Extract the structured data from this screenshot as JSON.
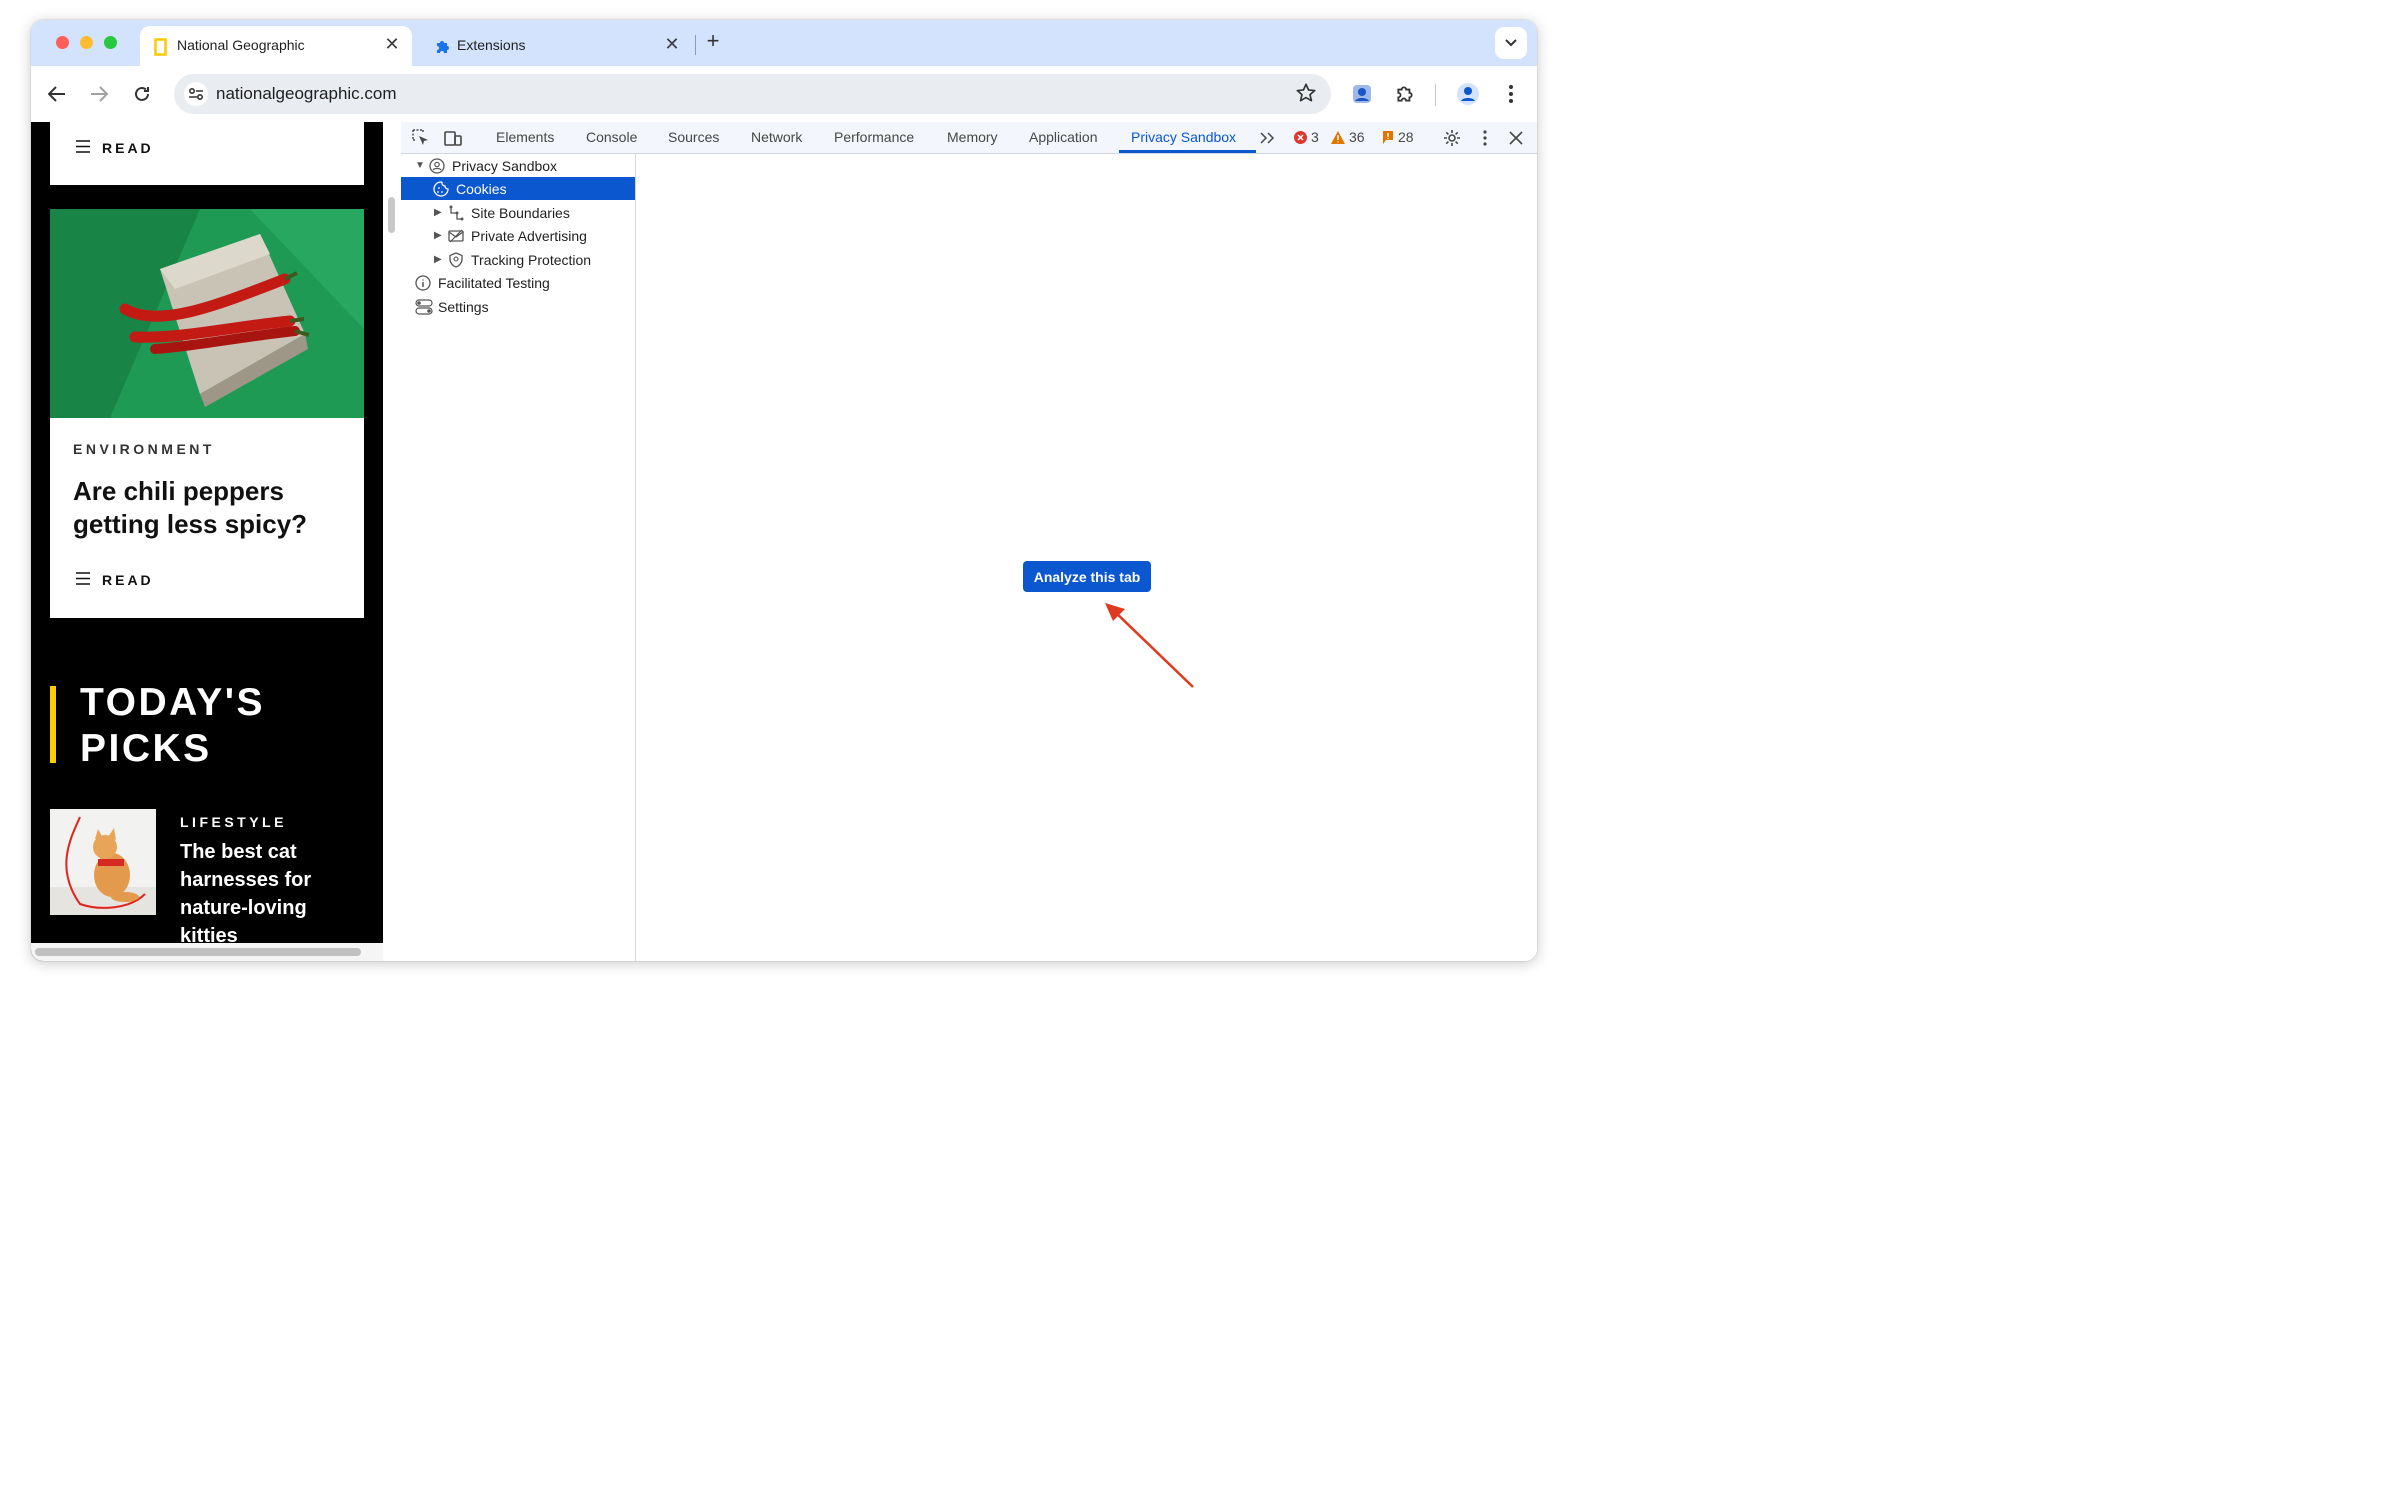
{
  "browser": {
    "tabs": [
      {
        "title": "National Geographic",
        "active": true,
        "favicon": "natgeo-yellow-rect-icon"
      },
      {
        "title": "Extensions",
        "active": false,
        "favicon": "puzzle-icon"
      }
    ],
    "url": "nationalgeographic.com"
  },
  "page": {
    "read_label_top": "READ",
    "card": {
      "kicker": "ENVIRONMENT",
      "headline": "Are chili peppers getting less spicy?",
      "read_label": "READ"
    },
    "section_title": "TODAY'S PICKS",
    "pick": {
      "kicker": "LIFESTYLE",
      "headline": "The best cat harnesses for nature-loving kitties"
    }
  },
  "devtools": {
    "tabs": [
      "Elements",
      "Console",
      "Sources",
      "Network",
      "Performance",
      "Memory",
      "Application",
      "Privacy Sandbox"
    ],
    "active_tab": "Privacy Sandbox",
    "counts": {
      "errors": "3",
      "warnings": "36",
      "issues": "28"
    },
    "tree": {
      "root": "Privacy Sandbox",
      "items": [
        "Cookies",
        "Site Boundaries",
        "Private Advertising",
        "Tracking Protection",
        "Facilitated Testing",
        "Settings"
      ],
      "selected": "Cookies"
    },
    "analyze_button": "Analyze this tab"
  },
  "colors": {
    "accent": "#0b57d0",
    "tabstrip": "#d3e3fd",
    "natgeo_yellow": "#fccc0a",
    "annotation_arrow": "#e03a1e",
    "error": "#dc362e",
    "warning": "#e37400"
  }
}
